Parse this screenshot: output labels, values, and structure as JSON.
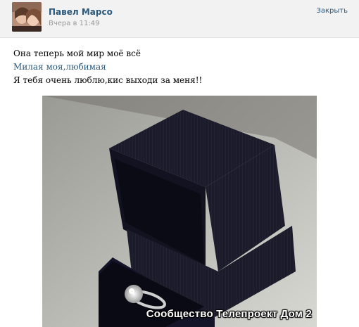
{
  "post": {
    "author": "Павел Марсо",
    "time": "Вчера в 11:49",
    "close_label": "Закрыть",
    "lines": [
      "Она теперь мой мир моё всё",
      "Милая моя,любимая",
      "Я тебя очень люблю,кис выходи за меня!!"
    ],
    "watermark": "Сообщество Телепроект Дом 2"
  }
}
